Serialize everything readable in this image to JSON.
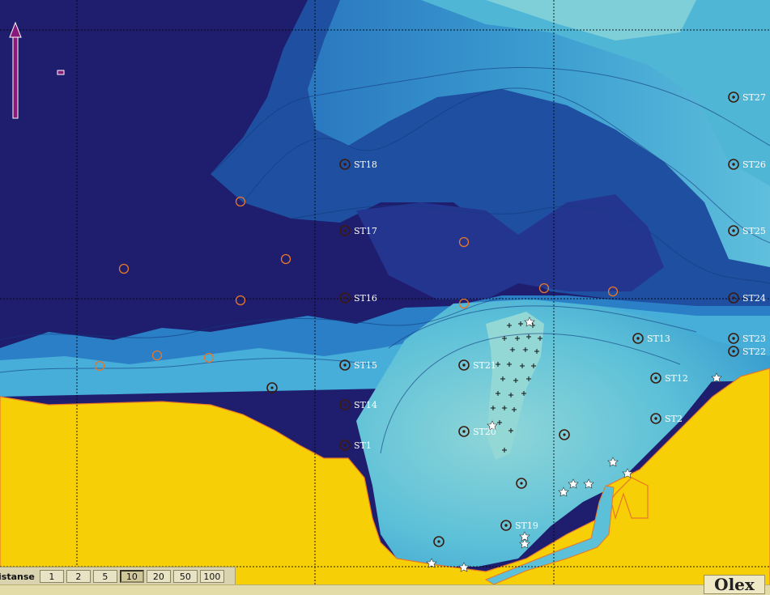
{
  "map": {
    "colors": {
      "deep": "#1f1e6e",
      "deep2": "#243590",
      "mid": "#1f5fb3",
      "mid2": "#2a8ccc",
      "shallow": "#4fb6d6",
      "shallow2": "#7fcfd9",
      "land": "#f6cf06",
      "shore": "#e8762a",
      "grid": "#000000",
      "station_ring": "#e8762a"
    },
    "stations": [
      {
        "label": "ST18"
      },
      {
        "label": "ST17"
      },
      {
        "label": "ST16"
      },
      {
        "label": "ST15"
      },
      {
        "label": "ST14"
      },
      {
        "label": "ST1"
      },
      {
        "label": "ST21"
      },
      {
        "label": "ST20"
      },
      {
        "label": "ST19"
      },
      {
        "label": "ST13"
      },
      {
        "label": "ST12"
      },
      {
        "label": "ST2"
      },
      {
        "label": "ST27"
      },
      {
        "label": "ST26"
      },
      {
        "label": "ST25"
      },
      {
        "label": "ST24"
      },
      {
        "label": "ST23"
      },
      {
        "label": "ST22"
      }
    ]
  },
  "distance_bar": {
    "label": "istanse",
    "options": [
      "1",
      "2",
      "5",
      "10",
      "20",
      "50",
      "100"
    ],
    "selected": "10"
  },
  "logo": "Olex"
}
